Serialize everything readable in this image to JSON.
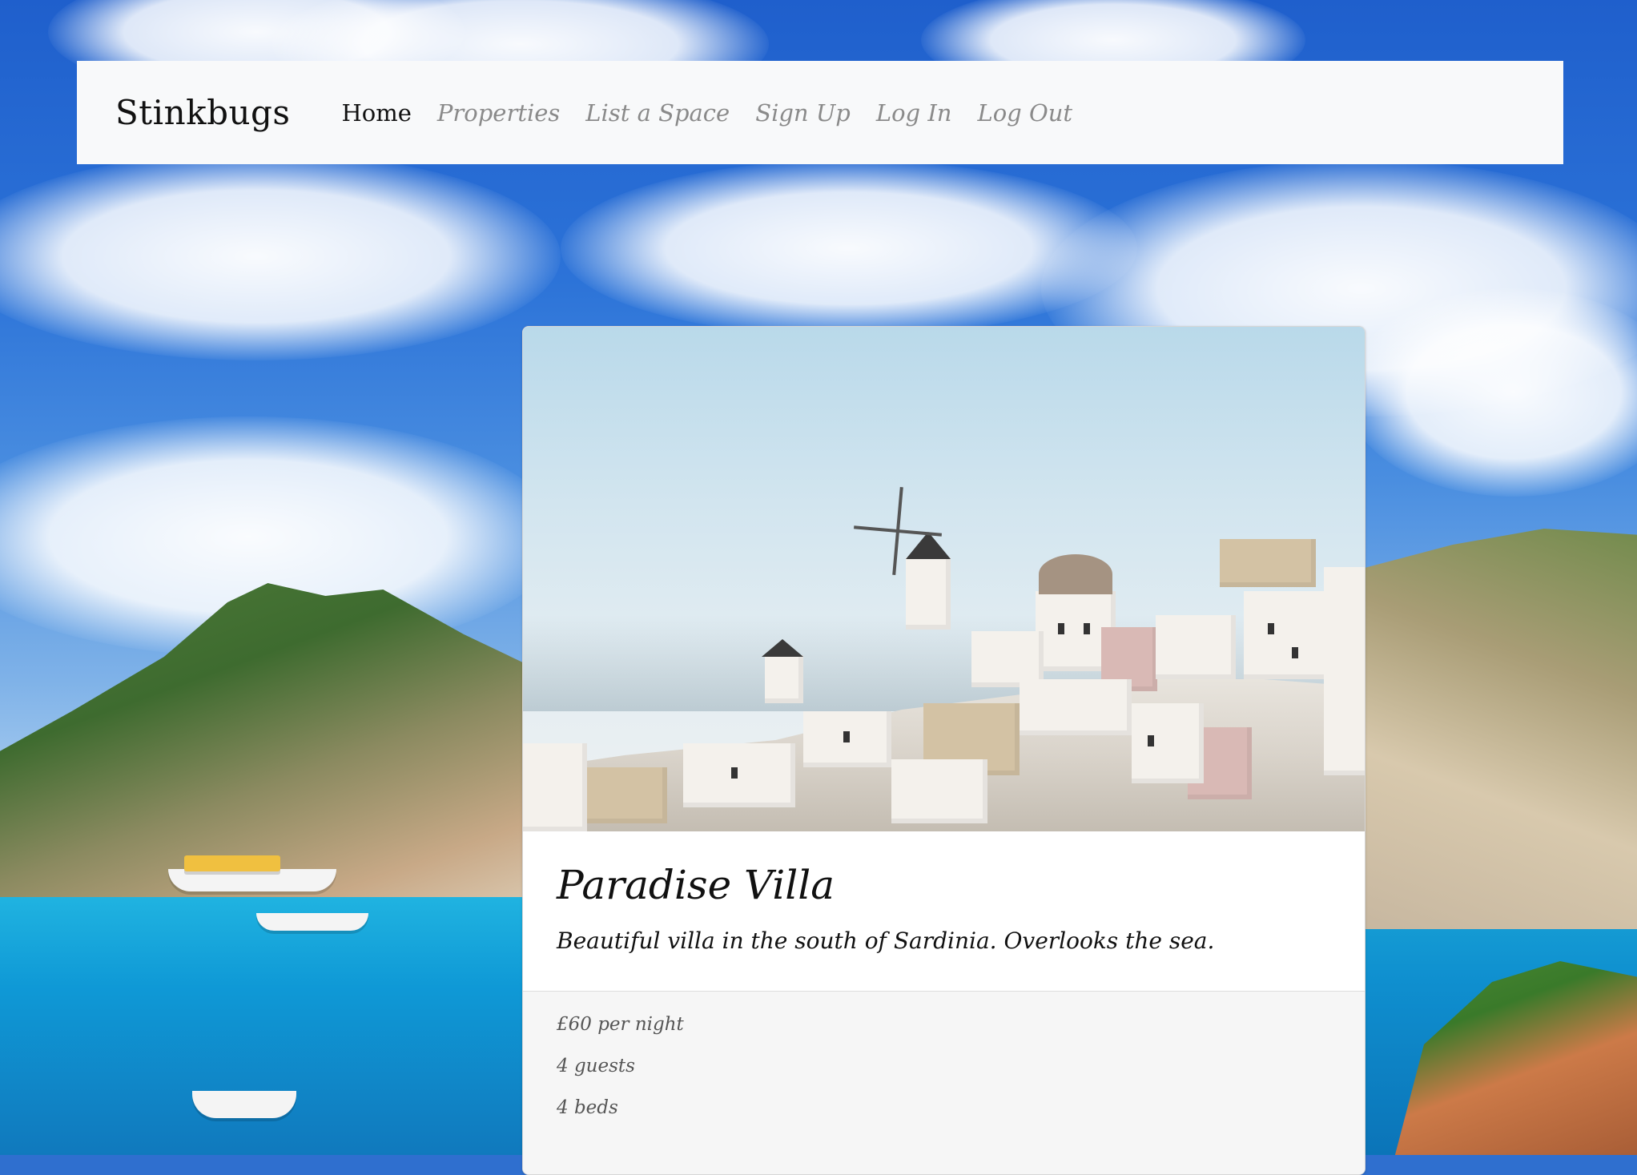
{
  "navbar": {
    "brand": "Stinkbugs",
    "links": [
      {
        "label": "Home",
        "active": true
      },
      {
        "label": "Properties",
        "active": false
      },
      {
        "label": "List a Space",
        "active": false
      },
      {
        "label": "Sign Up",
        "active": false
      },
      {
        "label": "Log In",
        "active": false
      },
      {
        "label": "Log Out",
        "active": false
      }
    ]
  },
  "property": {
    "title": "Paradise Villa",
    "description": "Beautiful villa in the south of Sardinia. Overlooks the sea.",
    "price": "£60 per night",
    "guests": "4 guests",
    "beds": "4 beds"
  },
  "colors": {
    "navbar_bg": "#f8f9fa",
    "sky": "#2c73d8",
    "sea": "#0f8fcf",
    "card_bg": "#ffffff",
    "footer_bg": "#f6f6f6"
  }
}
